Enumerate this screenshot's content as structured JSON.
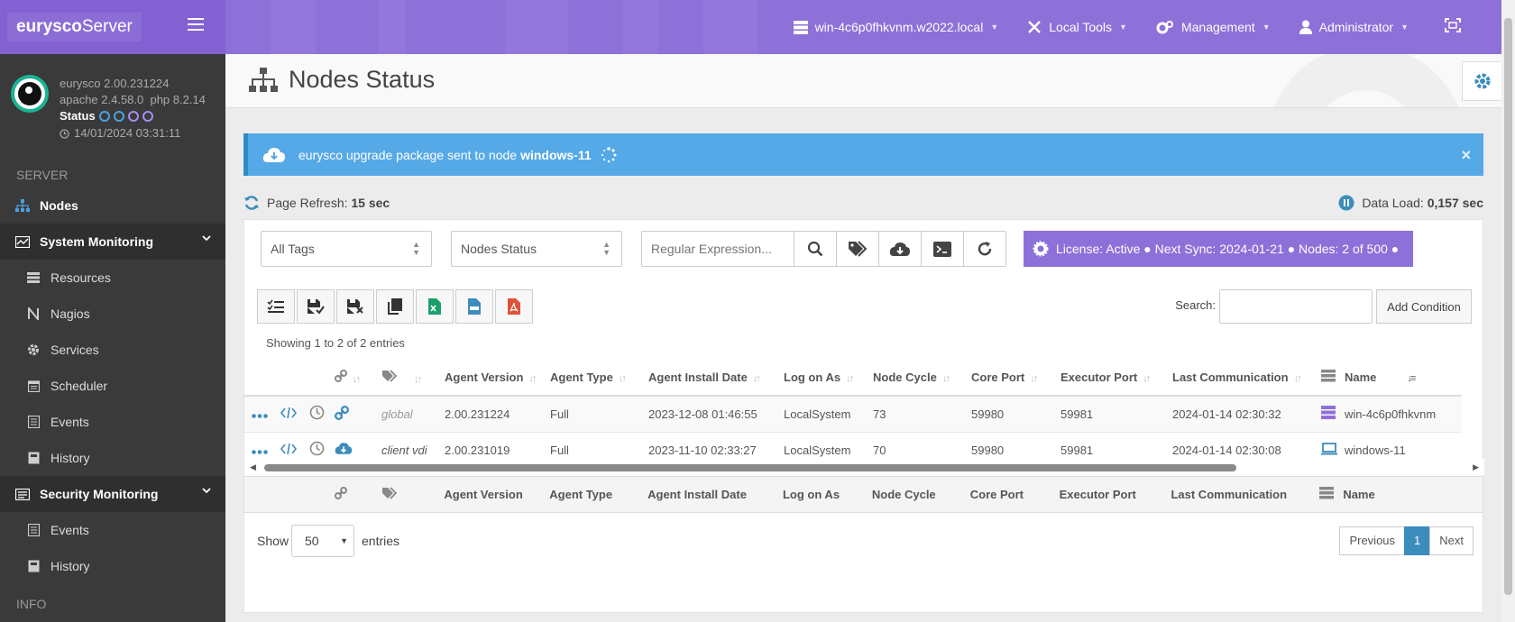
{
  "brand": {
    "bold": "eurysco",
    "rest": "Server"
  },
  "topnav": {
    "host": "win-4c6p0fhkvnm.w2022.local",
    "local_tools": "Local Tools",
    "management": "Management",
    "user": "Administrator"
  },
  "userpanel": {
    "version": "eurysco 2.00.231224",
    "stack": "apache 2.4.58.0  php 8.2.14",
    "status_label": "Status",
    "datetime": "14/01/2024 03:31:11"
  },
  "sidebar": {
    "server_header": "SERVER",
    "nodes": "Nodes",
    "system_monitoring": "System Monitoring",
    "sys_items": [
      "Resources",
      "Nagios",
      "Services",
      "Scheduler",
      "Events",
      "History"
    ],
    "security_monitoring": "Security Monitoring",
    "sec_items": [
      "Events",
      "History"
    ],
    "info_header": "INFO"
  },
  "page": {
    "title": "Nodes Status"
  },
  "alert": {
    "text": "eurysco upgrade package sent to node",
    "node": "windows-11",
    "close": "×"
  },
  "refresh": {
    "label": "Page Refresh:",
    "value": "15 sec"
  },
  "dataload": {
    "label": "Data Load:",
    "value": "0,157 sec"
  },
  "filters": {
    "tags": "All Tags",
    "view": "Nodes Status",
    "regex_placeholder": "Regular Expression..."
  },
  "license": {
    "text": "License: Active ● Next Sync: 2024-01-21 ● Nodes: 2 of 500 ●"
  },
  "search": {
    "label": "Search:",
    "value": ""
  },
  "add_condition": "Add Condition",
  "showing": "Showing 1 to 2 of 2 entries",
  "table": {
    "headers": {
      "agent_version": "Agent Version",
      "agent_type": "Agent Type",
      "install_date": "Agent Install Date",
      "log_on_as": "Log on As",
      "node_cycle": "Node Cycle",
      "core_port": "Core Port",
      "executor_port": "Executor Port",
      "last_comm": "Last Communication",
      "name": "Name"
    },
    "rows": [
      {
        "tags": "global",
        "agent_version": "2.00.231224",
        "agent_type": "Full",
        "install_date": "2023-12-08 01:46:55",
        "log_on_as": "LocalSystem",
        "node_cycle": "73",
        "core_port": "59980",
        "executor_port": "59981",
        "last_comm": "2024-01-14 02:30:32",
        "name": "win-4c6p0fhkvnm"
      },
      {
        "tags": "client vdi",
        "agent_version": "2.00.231019",
        "agent_type": "Full",
        "install_date": "2023-11-10 02:33:27",
        "log_on_as": "LocalSystem",
        "node_cycle": "70",
        "core_port": "59980",
        "executor_port": "59981",
        "last_comm": "2024-01-14 02:30:08",
        "name": "windows-11"
      }
    ]
  },
  "length": {
    "show": "Show",
    "value": "50",
    "entries": "entries"
  },
  "pager": {
    "prev": "Previous",
    "page": "1",
    "next": "Next"
  },
  "colors": {
    "accent": "#8e70d9",
    "info": "#55a9e6",
    "sidebar": "#3a3a3a"
  }
}
